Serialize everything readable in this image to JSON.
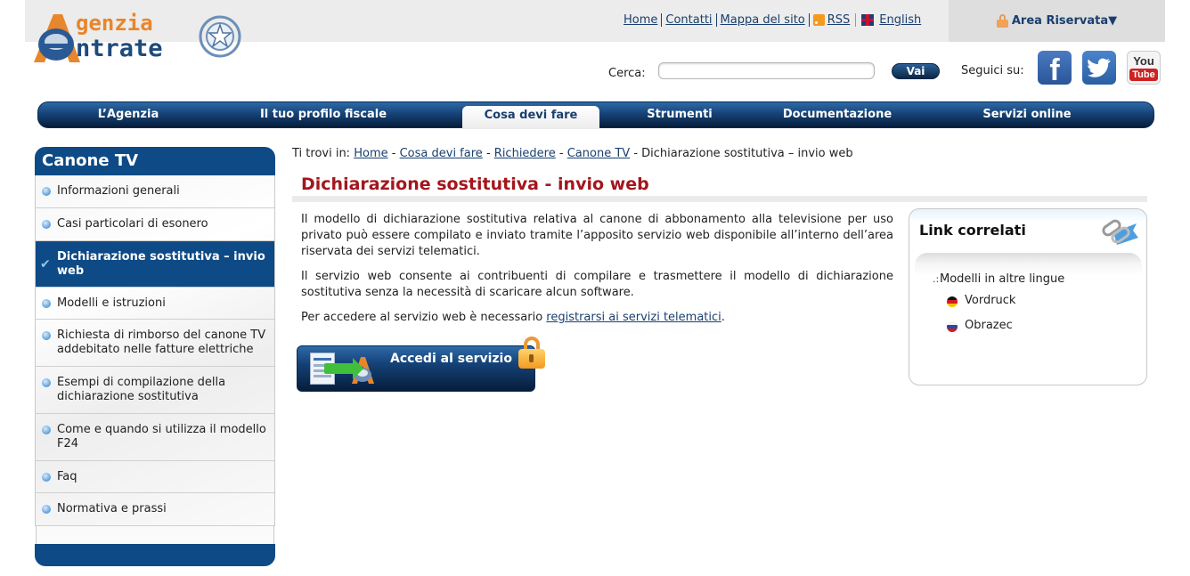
{
  "header": {
    "logo": {
      "line1": "genzia",
      "line2": "ntrate",
      "alt": "Agenzia Entrate"
    },
    "top_links": [
      {
        "label": "Home"
      },
      {
        "label": "Contatti"
      },
      {
        "label": "Mappa del sito"
      },
      {
        "label": "RSS",
        "icon": "rss-icon"
      },
      {
        "label": "English",
        "icon": "uk-flag-icon"
      }
    ],
    "area_riservata": {
      "label": "Area Riservata",
      "caret": "▼",
      "icon": "lock-icon"
    },
    "search": {
      "label": "Cerca:",
      "value": "",
      "placeholder": "",
      "button": "Vai"
    },
    "social": {
      "label": "Seguici su:",
      "facebook": "f",
      "twitter": "🐦",
      "youtube_top": "You",
      "youtube_bottom": "Tube"
    }
  },
  "nav": {
    "items": [
      {
        "label": "L’Agenzia",
        "active": false
      },
      {
        "label": "Il tuo profilo fiscale",
        "active": false
      },
      {
        "label": "Cosa devi fare",
        "active": true
      },
      {
        "label": "Strumenti",
        "active": false
      },
      {
        "label": "Documentazione",
        "active": false
      },
      {
        "label": "Servizi online",
        "active": false
      }
    ]
  },
  "sidebar": {
    "title": "Canone TV",
    "items": [
      {
        "label": "Informazioni generali",
        "active": false
      },
      {
        "label": "Casi particolari di esonero",
        "active": false
      },
      {
        "label": "Dichiarazione sostitutiva – invio web",
        "active": true
      },
      {
        "label": "Modelli e istruzioni",
        "active": false
      },
      {
        "label": "Richiesta di rimborso del canone TV addebitato nelle fatture elettriche",
        "active": false
      },
      {
        "label": "Esempi di compilazione della dichiarazione sostitutiva",
        "active": false
      },
      {
        "label": "Come e quando si utilizza il modello F24",
        "active": false
      },
      {
        "label": "Faq",
        "active": false
      },
      {
        "label": "Normativa e prassi",
        "active": false
      }
    ]
  },
  "breadcrumb": {
    "prefix": "Ti trovi in:",
    "links": [
      "Home",
      "Cosa devi fare",
      "Richiedere",
      "Canone TV"
    ],
    "current": "Dichiarazione sostitutiva – invio web",
    "separator": "-"
  },
  "main": {
    "title": "Dichiarazione sostitutiva - invio web",
    "paragraphs": [
      "Il modello di dichiarazione sostitutiva relativa al canone di abbonamento alla televisione per uso privato può essere compilato e inviato tramite l’apposito servizio web disponibile all’interno dell’area riservata dei servizi telematici.",
      "Il servizio web consente ai contribuenti di compilare e trasmettere il modello di dichiarazione sostitutiva senza la necessità di scaricare alcun software."
    ],
    "access_text": "Per accedere al servizio web è necessario ",
    "access_link": "registrarsi ai servizi telematici",
    "access_end": ".",
    "service_button": "Accedi al servizio"
  },
  "related": {
    "title": "Link correlati",
    "group": "Modelli in altre lingue",
    "links": [
      {
        "label": "Vordruck",
        "flag": "german-flag-icon"
      },
      {
        "label": "Obrazec",
        "flag": "russian-flag-icon"
      }
    ]
  }
}
